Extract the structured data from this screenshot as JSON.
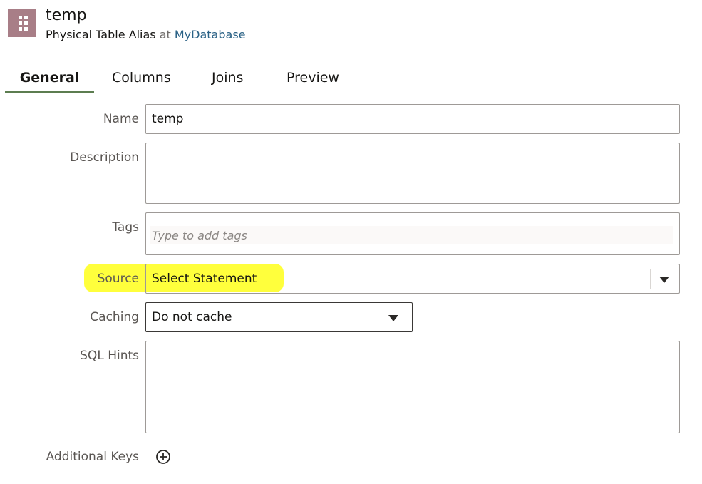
{
  "header": {
    "icon": "table-grid-icon",
    "icon_color": "#a87e87",
    "title": "temp",
    "subtitle_type": "Physical Table Alias",
    "subtitle_at": "at",
    "subtitle_database": "MyDatabase"
  },
  "tabs": [
    {
      "label": "General",
      "active": true
    },
    {
      "label": "Columns",
      "active": false
    },
    {
      "label": "Joins",
      "active": false
    },
    {
      "label": "Preview",
      "active": false
    }
  ],
  "form": {
    "name": {
      "label": "Name",
      "value": "temp"
    },
    "description": {
      "label": "Description",
      "value": ""
    },
    "tags": {
      "label": "Tags",
      "placeholder": "Type to add tags"
    },
    "source": {
      "label": "Source",
      "value": "Select Statement",
      "highlight_color": "#ffff3c"
    },
    "caching": {
      "label": "Caching",
      "value": "Do not cache"
    },
    "sql_hints": {
      "label": "SQL Hints",
      "value": ""
    },
    "additional_keys": {
      "label": "Additional Keys",
      "add_icon": "plus-circle-icon"
    }
  },
  "colors": {
    "accent_tab_underline": "#5c7d50",
    "link": "#2b6286"
  }
}
